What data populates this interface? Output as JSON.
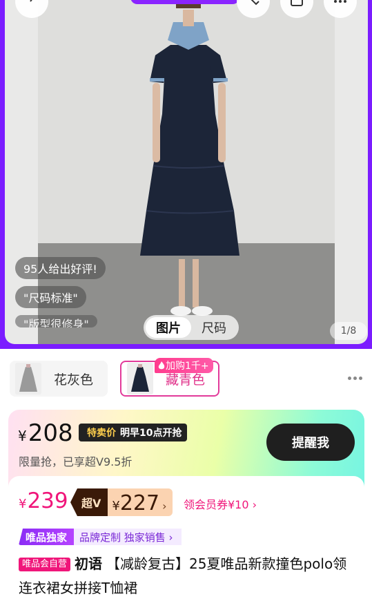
{
  "hero": {
    "reviews": [
      "95人给出好评!",
      "\"尺码标准\"",
      "\"版型很修身\""
    ],
    "tabs": [
      "图片",
      "尺码"
    ],
    "active_tab": "图片",
    "page_indicator": "1/8",
    "icons": [
      "back-arrow-icon",
      "tag-add-icon",
      "share-icon",
      "more-icon"
    ]
  },
  "variants": [
    {
      "label": "花灰色",
      "selected": false
    },
    {
      "label": "藏青色",
      "selected": true,
      "badge": "加购1千+"
    }
  ],
  "flash": {
    "currency": "¥",
    "price": "208",
    "tag_label": "特卖价",
    "tag_time": "明早10点开抢",
    "limit_text": "限量抢，已享超V9.5折",
    "remind_button": "提醒我"
  },
  "price": {
    "currency": "¥",
    "original": "239",
    "svip_label": "超V",
    "svip_price": "227",
    "svip_chevron": "›",
    "coupon": "领会员券¥10 ›"
  },
  "brand": {
    "tag": "唯品独家",
    "sub": "品牌定制 独家销售 ›"
  },
  "product": {
    "self_tag": "唯品会自营",
    "brand": "初语",
    "title": "【减龄复古】25夏唯品新款撞色polo领连衣裙女拼接T恤裙"
  },
  "colors": {
    "accent": "#7b1cff",
    "pink": "#f0167a",
    "dress": "#1c2538"
  }
}
